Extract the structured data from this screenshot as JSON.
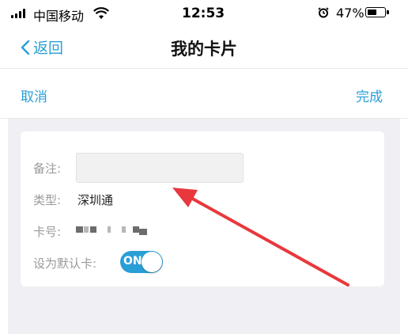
{
  "status_bar": {
    "carrier": "中国移动",
    "time": "12:53",
    "battery_percent": "47%",
    "battery_level": 0.47
  },
  "nav": {
    "back_label": "返回",
    "title": "我的卡片"
  },
  "actions": {
    "cancel_label": "取消",
    "done_label": "完成"
  },
  "form": {
    "remark_label": "备注:",
    "remark_value": "",
    "type_label": "类型:",
    "type_value": "深圳通",
    "card_no_label": "卡号:",
    "default_label": "设为默认卡:",
    "default_toggle_text": "ON",
    "default_enabled": true
  },
  "colors": {
    "accent": "#2a9fd6",
    "arrow": "#e8383d",
    "background": "#efeff4"
  }
}
